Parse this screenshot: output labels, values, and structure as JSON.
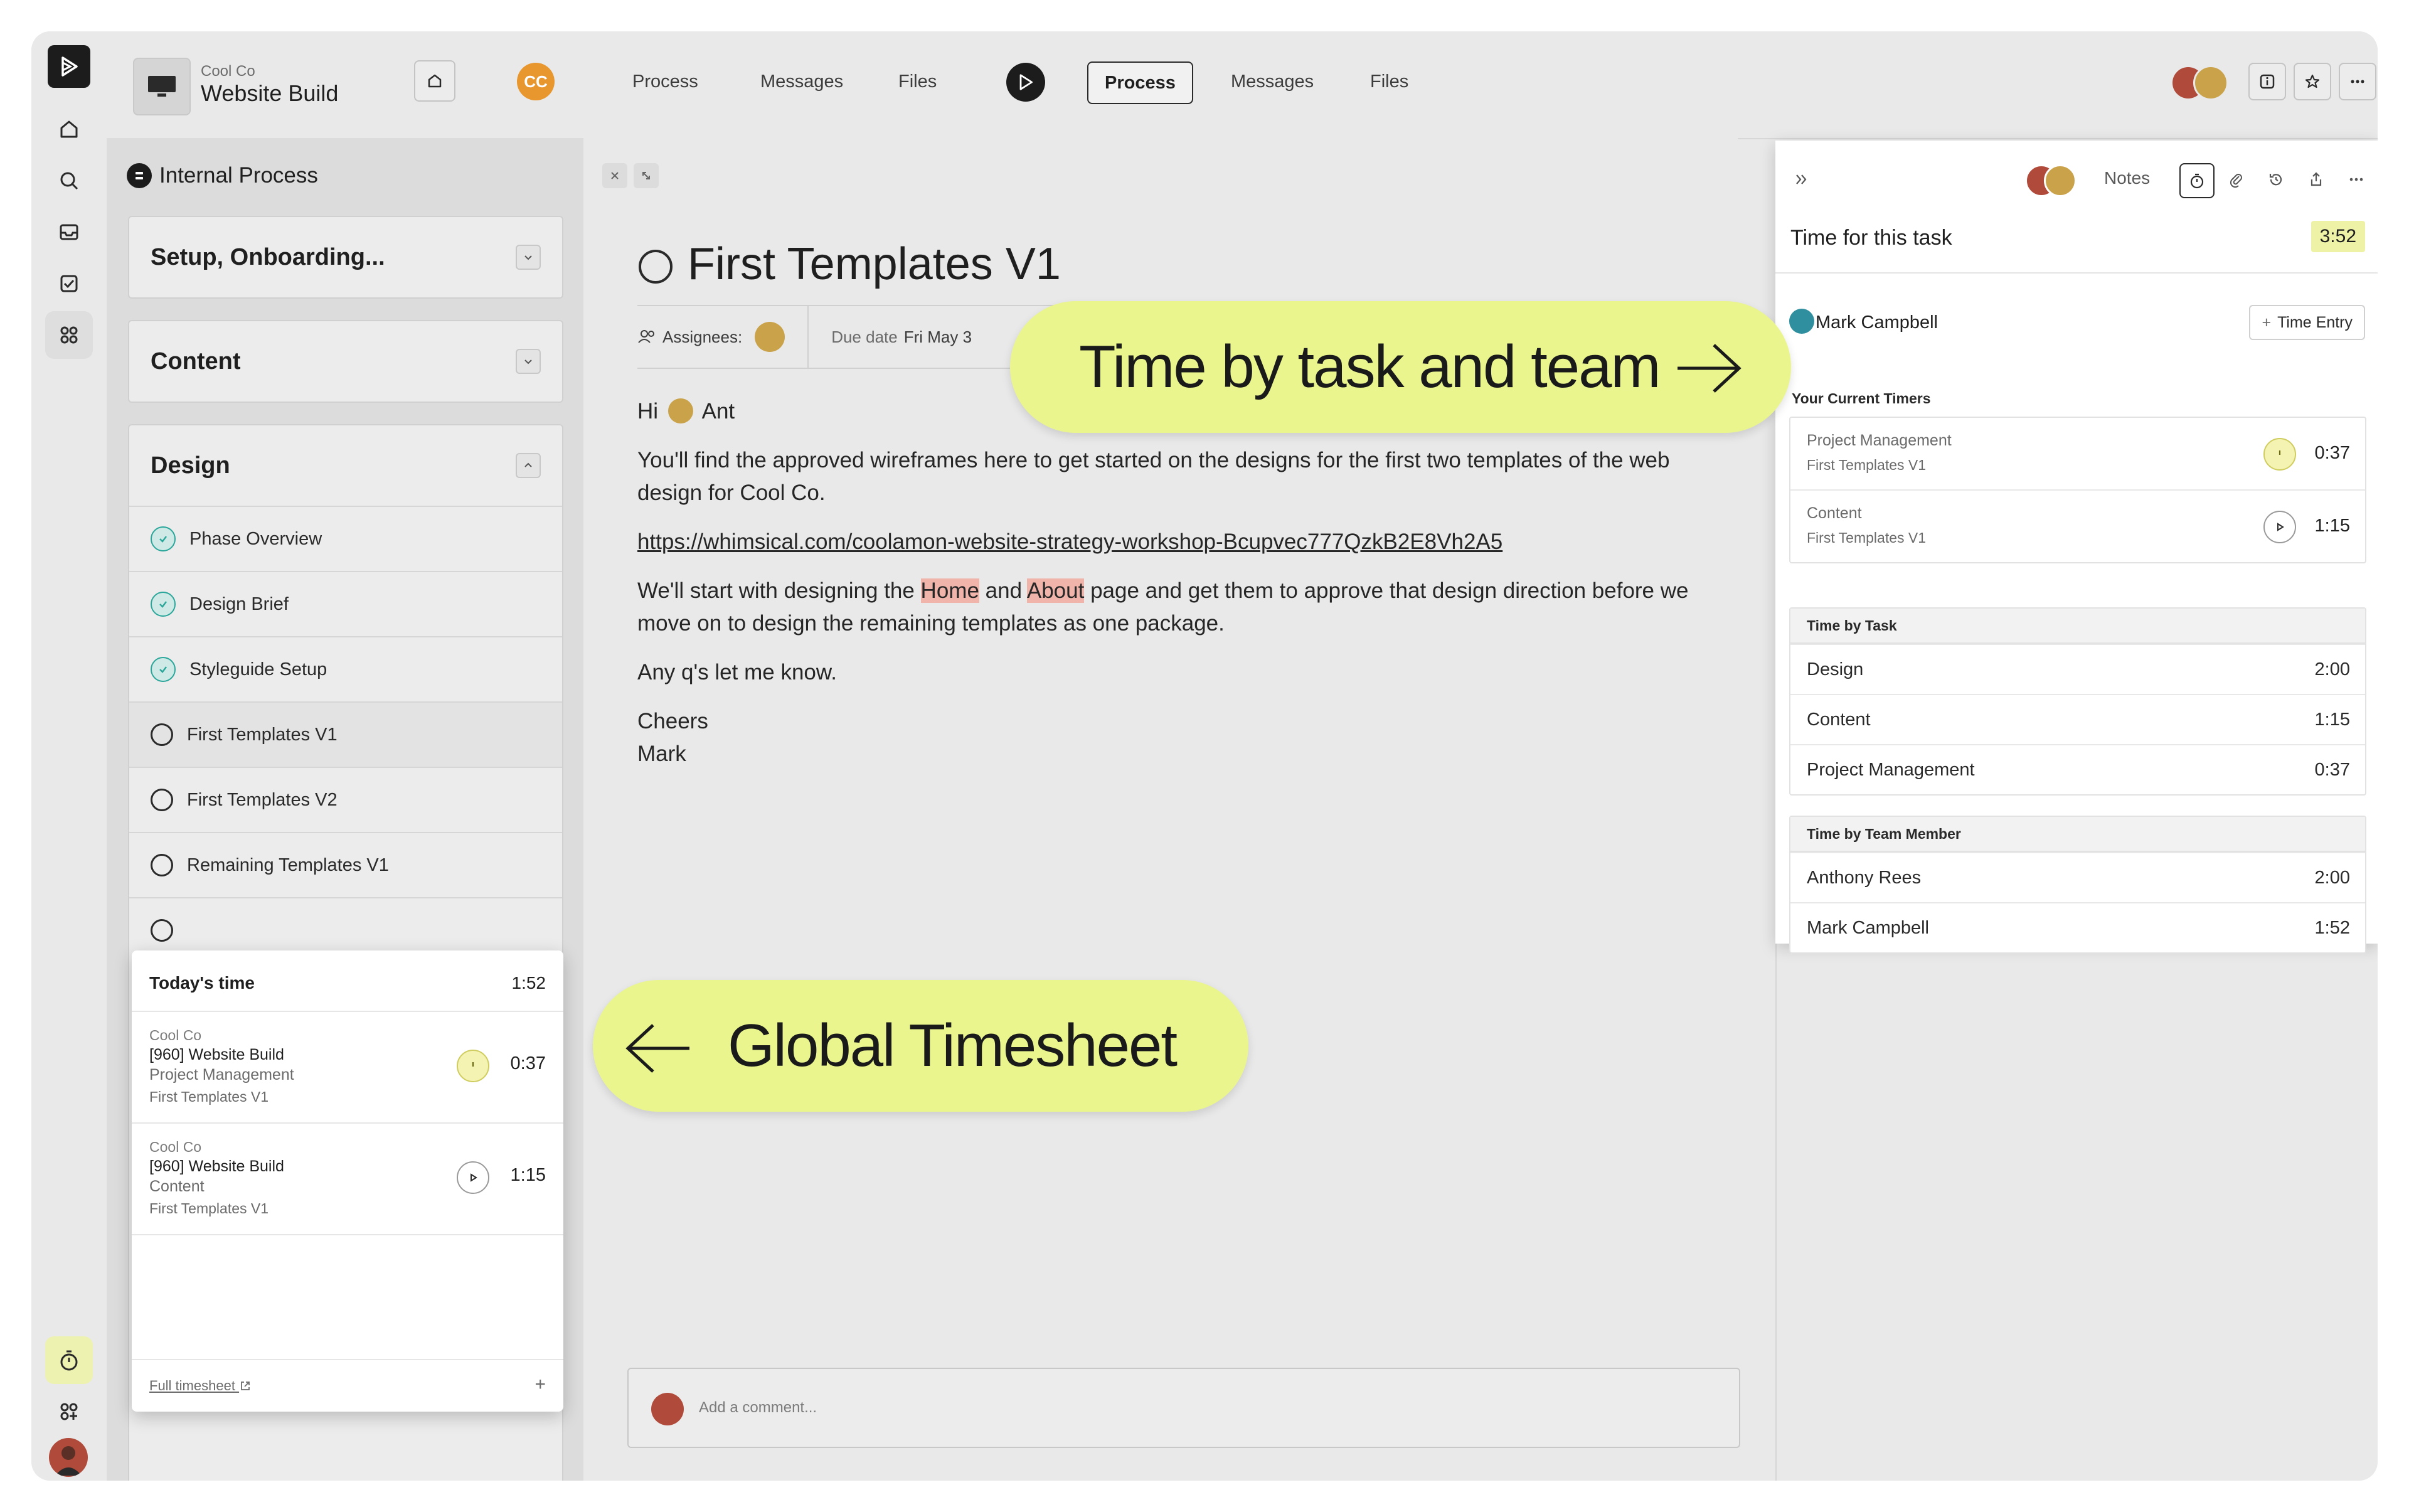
{
  "header": {
    "client": "Cool Co",
    "project": "Website Build",
    "client_initials": "CC",
    "nav_left": [
      "Process",
      "Messages",
      "Files"
    ],
    "nav_right": [
      "Process",
      "Messages",
      "Files"
    ]
  },
  "process": {
    "title": "Internal Process",
    "phases": [
      {
        "name": "Setup, Onboarding...",
        "expanded": false
      },
      {
        "name": "Content",
        "expanded": false
      },
      {
        "name": "Design",
        "expanded": true
      }
    ],
    "design_tasks": [
      {
        "label": "Phase Overview",
        "done": true
      },
      {
        "label": "Design Brief",
        "done": true
      },
      {
        "label": "Styleguide Setup",
        "done": true
      },
      {
        "label": "First Templates V1",
        "done": false
      },
      {
        "label": "First Templates V2",
        "done": false
      },
      {
        "label": "Remaining Templates V1",
        "done": false
      }
    ]
  },
  "task": {
    "title": "First Templates V1",
    "assignees_label": "Assignees:",
    "due_label": "Due date",
    "due_value": "Fri May 3",
    "greeting_hi": "Hi",
    "greeting_name": "Ant",
    "p1": "You'll find the approved wireframes here to get started on the designs for the first two templates of the web design for Cool Co.",
    "link": "https://whimsical.com/coolamon-website-strategy-workshop-Bcupvec777QzkB2E8Vh2A5",
    "p3_a": "We'll start with designing the",
    "p3_home": "Home",
    "p3_and": "and",
    "p3_about": "About",
    "p3_b": "page and get them to approve that design direction before we move on to design the remaining templates as one package.",
    "p4": "Any q's let me know.",
    "p5a": "Cheers",
    "p5b": "Mark",
    "comment_placeholder": "Add a comment..."
  },
  "time_panel": {
    "notes_label": "Notes",
    "title": "Time for this task",
    "total": "3:52",
    "user": "Mark Campbell",
    "time_entry_btn": "Time Entry",
    "current_timers_label": "Your Current Timers",
    "timers": [
      {
        "task": "Project Management",
        "sub": "First Templates V1",
        "time": "0:37",
        "state": "running"
      },
      {
        "task": "Content",
        "sub": "First Templates V1",
        "time": "1:15",
        "state": "paused"
      }
    ],
    "by_task_label": "Time by Task",
    "by_task": [
      {
        "name": "Design",
        "time": "2:00"
      },
      {
        "name": "Content",
        "time": "1:15"
      },
      {
        "name": "Project Management",
        "time": "0:37"
      }
    ],
    "by_member_label": "Time by Team Member",
    "by_member": [
      {
        "name": "Anthony Rees",
        "time": "2:00"
      },
      {
        "name": "Mark Campbell",
        "time": "1:52"
      }
    ]
  },
  "timesheet": {
    "title": "Today's time",
    "total": "1:52",
    "entries": [
      {
        "client": "Cool Co",
        "project": "[960] Website Build",
        "task": "Project Management",
        "phase": "First Templates V1",
        "time": "0:37",
        "state": "running"
      },
      {
        "client": "Cool Co",
        "project": "[960] Website Build",
        "task": "Content",
        "phase": "First Templates V1",
        "time": "1:15",
        "state": "paused"
      }
    ],
    "footer_link": "Full timesheet",
    "footer_plus": "+"
  },
  "callouts": {
    "task_team": "Time by task and team",
    "global": "Global Timesheet"
  },
  "colors": {
    "callout": "#eaf58e",
    "running_timer": "#f4f3b2",
    "done_check": "#2aa69a",
    "highlight": "#f0b4ab",
    "client_badge": "#e8962e"
  }
}
